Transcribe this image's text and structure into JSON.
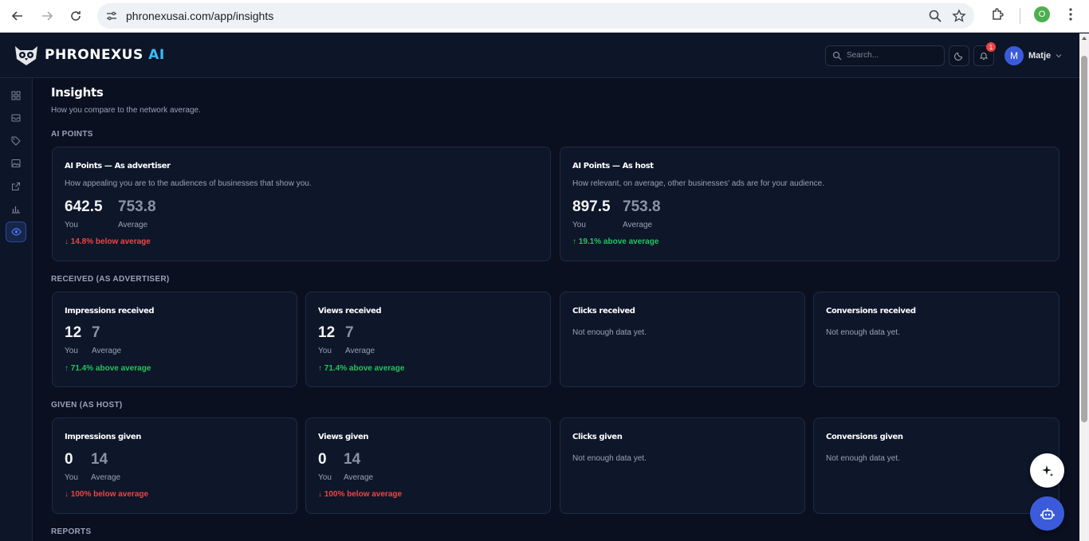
{
  "browser": {
    "url": "phronexusai.com/app/insights",
    "profile_initial": "O"
  },
  "header": {
    "brand": "PHRONEXUS",
    "brand_suffix": "AI",
    "search_placeholder": "Search...",
    "notification_count": "1",
    "user_initial": "M",
    "user_name": "Matje"
  },
  "sidebar": {
    "items": [
      "dashboard-icon",
      "inbox-icon",
      "tag-icon",
      "image-icon",
      "external-link-icon",
      "bar-chart-icon",
      "eye-icon"
    ],
    "active": "eye-icon"
  },
  "page": {
    "title": "Insights",
    "subtitle": "How you compare to the network average."
  },
  "sections": {
    "ai_points": "AI POINTS",
    "received": "RECEIVED (AS ADVERTISER)",
    "given": "GIVEN (AS HOST)",
    "reports": "REPORTS"
  },
  "ai_cards": [
    {
      "title": "AI Points — As advertiser",
      "desc": "How appealing you are to the audiences of businesses that show you.",
      "you": "642.5",
      "avg": "753.8",
      "you_label": "You",
      "avg_label": "Average",
      "delta": "↓ 14.8% below average",
      "direction": "down"
    },
    {
      "title": "AI Points — As host",
      "desc": "How relevant, on average, other businesses' ads are for your audience.",
      "you": "897.5",
      "avg": "753.8",
      "you_label": "You",
      "avg_label": "Average",
      "delta": "↑ 19.1% above average",
      "direction": "up"
    }
  ],
  "received_cards": [
    {
      "title": "Impressions received",
      "you": "12",
      "avg": "7",
      "you_label": "You",
      "avg_label": "Average",
      "delta": "↑ 71.4% above average",
      "direction": "up"
    },
    {
      "title": "Views received",
      "you": "12",
      "avg": "7",
      "you_label": "You",
      "avg_label": "Average",
      "delta": "↑ 71.4% above average",
      "direction": "up"
    },
    {
      "title": "Clicks received",
      "empty": "Not enough data yet."
    },
    {
      "title": "Conversions received",
      "empty": "Not enough data yet."
    }
  ],
  "given_cards": [
    {
      "title": "Impressions given",
      "you": "0",
      "avg": "14",
      "you_label": "You",
      "avg_label": "Average",
      "delta": "↓ 100% below average",
      "direction": "down"
    },
    {
      "title": "Views given",
      "you": "0",
      "avg": "14",
      "you_label": "You",
      "avg_label": "Average",
      "delta": "↓ 100% below average",
      "direction": "down"
    },
    {
      "title": "Clicks given",
      "empty": "Not enough data yet."
    },
    {
      "title": "Conversions given",
      "empty": "Not enough data yet."
    }
  ],
  "colors": {
    "background": "#0a1020",
    "card": "#0e1629",
    "accent": "#38bdf8",
    "positive": "#22c55e",
    "negative": "#f04444"
  }
}
